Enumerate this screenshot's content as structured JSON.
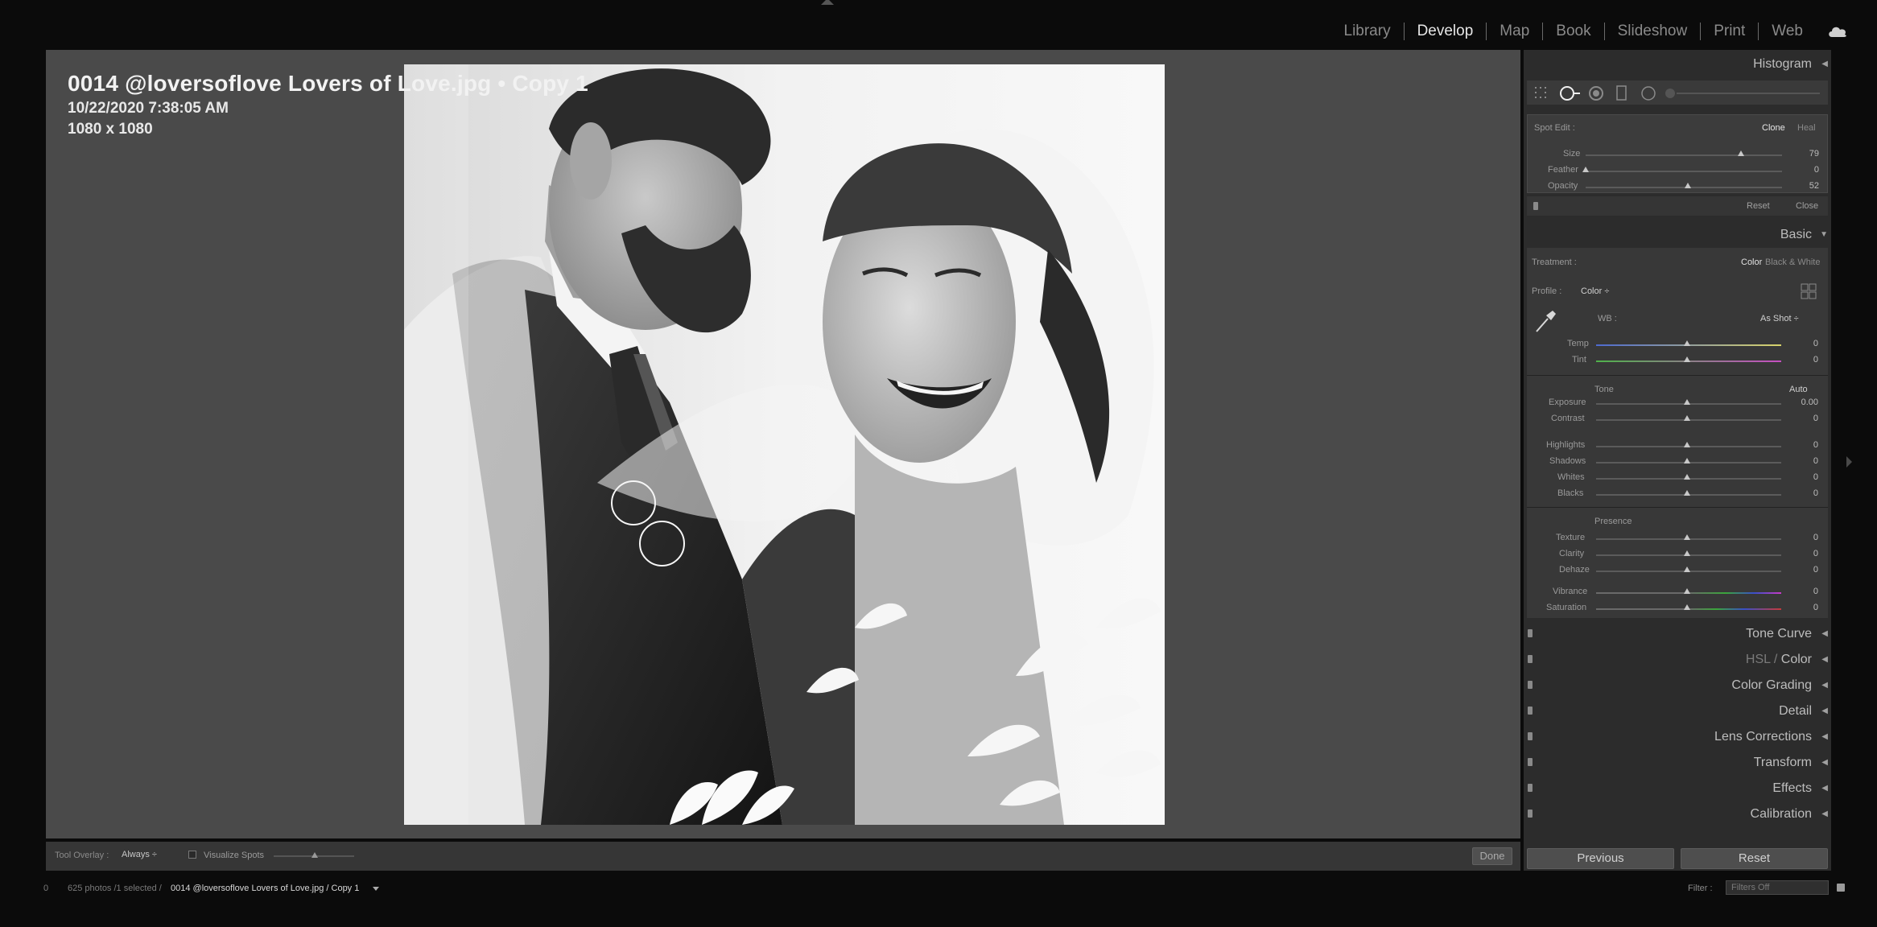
{
  "modules": {
    "library": "Library",
    "develop": "Develop",
    "map": "Map",
    "book": "Book",
    "slideshow": "Slideshow",
    "print": "Print",
    "web": "Web",
    "active": "Develop"
  },
  "image_info": {
    "title": "0014 @loversoflove Lovers of Love.jpg  •  Copy 1",
    "date": "10/22/2020 7:38:05 AM",
    "dimensions": "1080 x 1080"
  },
  "toolbar": {
    "tool_overlay_label": "Tool Overlay :",
    "tool_overlay_value": "Always ÷",
    "visualize_spots_label": "Visualize Spots",
    "done_label": "Done"
  },
  "panels": {
    "histogram": "Histogram",
    "spot_edit": {
      "label": "Spot Edit :",
      "clone": "Clone",
      "heal": "Heal",
      "size_label": "Size",
      "size_value": "79",
      "feather_label": "Feather",
      "feather_value": "0",
      "opacity_label": "Opacity",
      "opacity_value": "52",
      "reset": "Reset",
      "close": "Close"
    },
    "basic": {
      "title": "Basic",
      "treatment_label": "Treatment :",
      "treatment_color": "Color",
      "treatment_bw": "Black & White",
      "profile_label": "Profile :",
      "profile_value": "Color ÷",
      "wb_label": "WB :",
      "wb_value": "As Shot ÷",
      "temp_label": "Temp",
      "temp_value": "0",
      "tint_label": "Tint",
      "tint_value": "0",
      "tone_label": "Tone",
      "auto_label": "Auto",
      "exposure_label": "Exposure",
      "exposure_value": "0.00",
      "contrast_label": "Contrast",
      "contrast_value": "0",
      "highlights_label": "Highlights",
      "highlights_value": "0",
      "shadows_label": "Shadows",
      "shadows_value": "0",
      "whites_label": "Whites",
      "whites_value": "0",
      "blacks_label": "Blacks",
      "blacks_value": "0",
      "presence_label": "Presence",
      "texture_label": "Texture",
      "texture_value": "0",
      "clarity_label": "Clarity",
      "clarity_value": "0",
      "dehaze_label": "Dehaze",
      "dehaze_value": "0",
      "vibrance_label": "Vibrance",
      "vibrance_value": "0",
      "saturation_label": "Saturation",
      "saturation_value": "0"
    },
    "tone_curve": "Tone Curve",
    "hsl_prefix": "HSL / ",
    "hsl_color": "Color",
    "color_grading": "Color Grading",
    "detail": "Detail",
    "lens_corrections": "Lens Corrections",
    "transform": "Transform",
    "effects": "Effects",
    "calibration": "Calibration"
  },
  "nav": {
    "previous": "Previous",
    "reset": "Reset"
  },
  "statusbar": {
    "num": "0",
    "count": "625 photos /1 selected /",
    "file": "0014 @loversoflove Lovers of Love.jpg / Copy 1",
    "filter_label": "Filter :",
    "filter_value": "Filters Off"
  },
  "slider_levels": {
    "size": 0.79,
    "feather": 0.0,
    "opacity": 0.52
  },
  "colors": {
    "accent_text": "#e6e6e6",
    "panel_bg": "#2c2c2c",
    "workspace_bg": "#4a4a4a"
  }
}
